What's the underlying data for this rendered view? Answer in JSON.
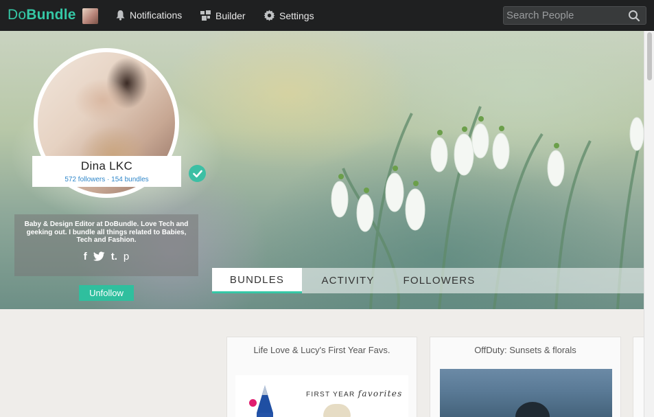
{
  "app": {
    "logo_do": "Do",
    "logo_bundle": "Bundle"
  },
  "nav": {
    "notifications": "Notifications",
    "builder": "Builder",
    "settings": "Settings",
    "search_placeholder": "Search People"
  },
  "profile": {
    "name": "Dina LKC",
    "counts": "572 followers · 154 bundles",
    "bio": "Baby & Design Editor at DoBundle. Love Tech and geeking out. I bundle all things related to Babies, Tech and Fashion.",
    "socials": [
      "f",
      "t",
      "t.",
      "p"
    ],
    "unfollow": "Unfollow"
  },
  "tabs": [
    "BUNDLES",
    "ACTIVITY",
    "FOLLOWERS"
  ],
  "active_tab": "BUNDLES",
  "bundles": [
    {
      "title": "Life Love & Lucy's First Year Favs.",
      "image_text_1": "FIRST YEAR",
      "image_text_2": "favorites"
    },
    {
      "title": "OffDuty: Sunsets & florals"
    }
  ],
  "colors": {
    "accent": "#35c8a6",
    "topbar": "#1f2021",
    "link": "#2e86c9"
  }
}
